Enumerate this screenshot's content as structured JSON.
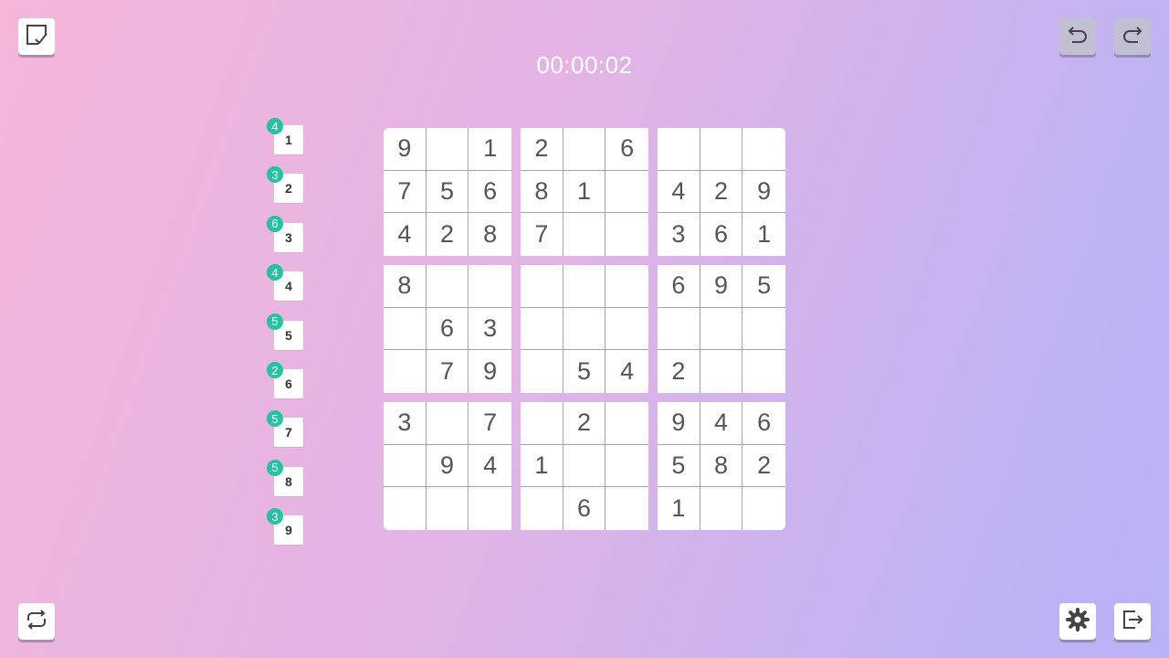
{
  "timer": "00:00:02",
  "buttons": {
    "check": "check-puzzle-icon",
    "undo": "undo-icon",
    "redo": "redo-icon",
    "restart": "restart-icon",
    "settings": "gear-icon",
    "exit": "exit-icon"
  },
  "colors": {
    "badge": "#24c3a2",
    "cell_text": "#555555",
    "grid_line": "#a6a6a6"
  },
  "number_counters": [
    {
      "digit": "1",
      "remaining": "4"
    },
    {
      "digit": "2",
      "remaining": "3"
    },
    {
      "digit": "3",
      "remaining": "6"
    },
    {
      "digit": "4",
      "remaining": "4"
    },
    {
      "digit": "5",
      "remaining": "5"
    },
    {
      "digit": "6",
      "remaining": "2"
    },
    {
      "digit": "7",
      "remaining": "5"
    },
    {
      "digit": "8",
      "remaining": "5"
    },
    {
      "digit": "9",
      "remaining": "3"
    }
  ],
  "grid": [
    [
      "9",
      "",
      "1",
      "2",
      "",
      "6",
      "",
      "",
      ""
    ],
    [
      "7",
      "5",
      "6",
      "8",
      "1",
      "",
      "4",
      "2",
      "9"
    ],
    [
      "4",
      "2",
      "8",
      "7",
      "",
      "",
      "3",
      "6",
      "1"
    ],
    [
      "8",
      "",
      "",
      "",
      "",
      "",
      "6",
      "9",
      "5"
    ],
    [
      "",
      "6",
      "3",
      "",
      "",
      "",
      "",
      "",
      ""
    ],
    [
      "",
      "7",
      "9",
      "",
      "5",
      "4",
      "2",
      "",
      ""
    ],
    [
      "3",
      "",
      "7",
      "",
      "2",
      "",
      "9",
      "4",
      "6"
    ],
    [
      "",
      "9",
      "4",
      "1",
      "",
      "",
      "5",
      "8",
      "2"
    ],
    [
      "",
      "",
      "",
      "",
      "6",
      "",
      "1",
      "",
      ""
    ]
  ]
}
